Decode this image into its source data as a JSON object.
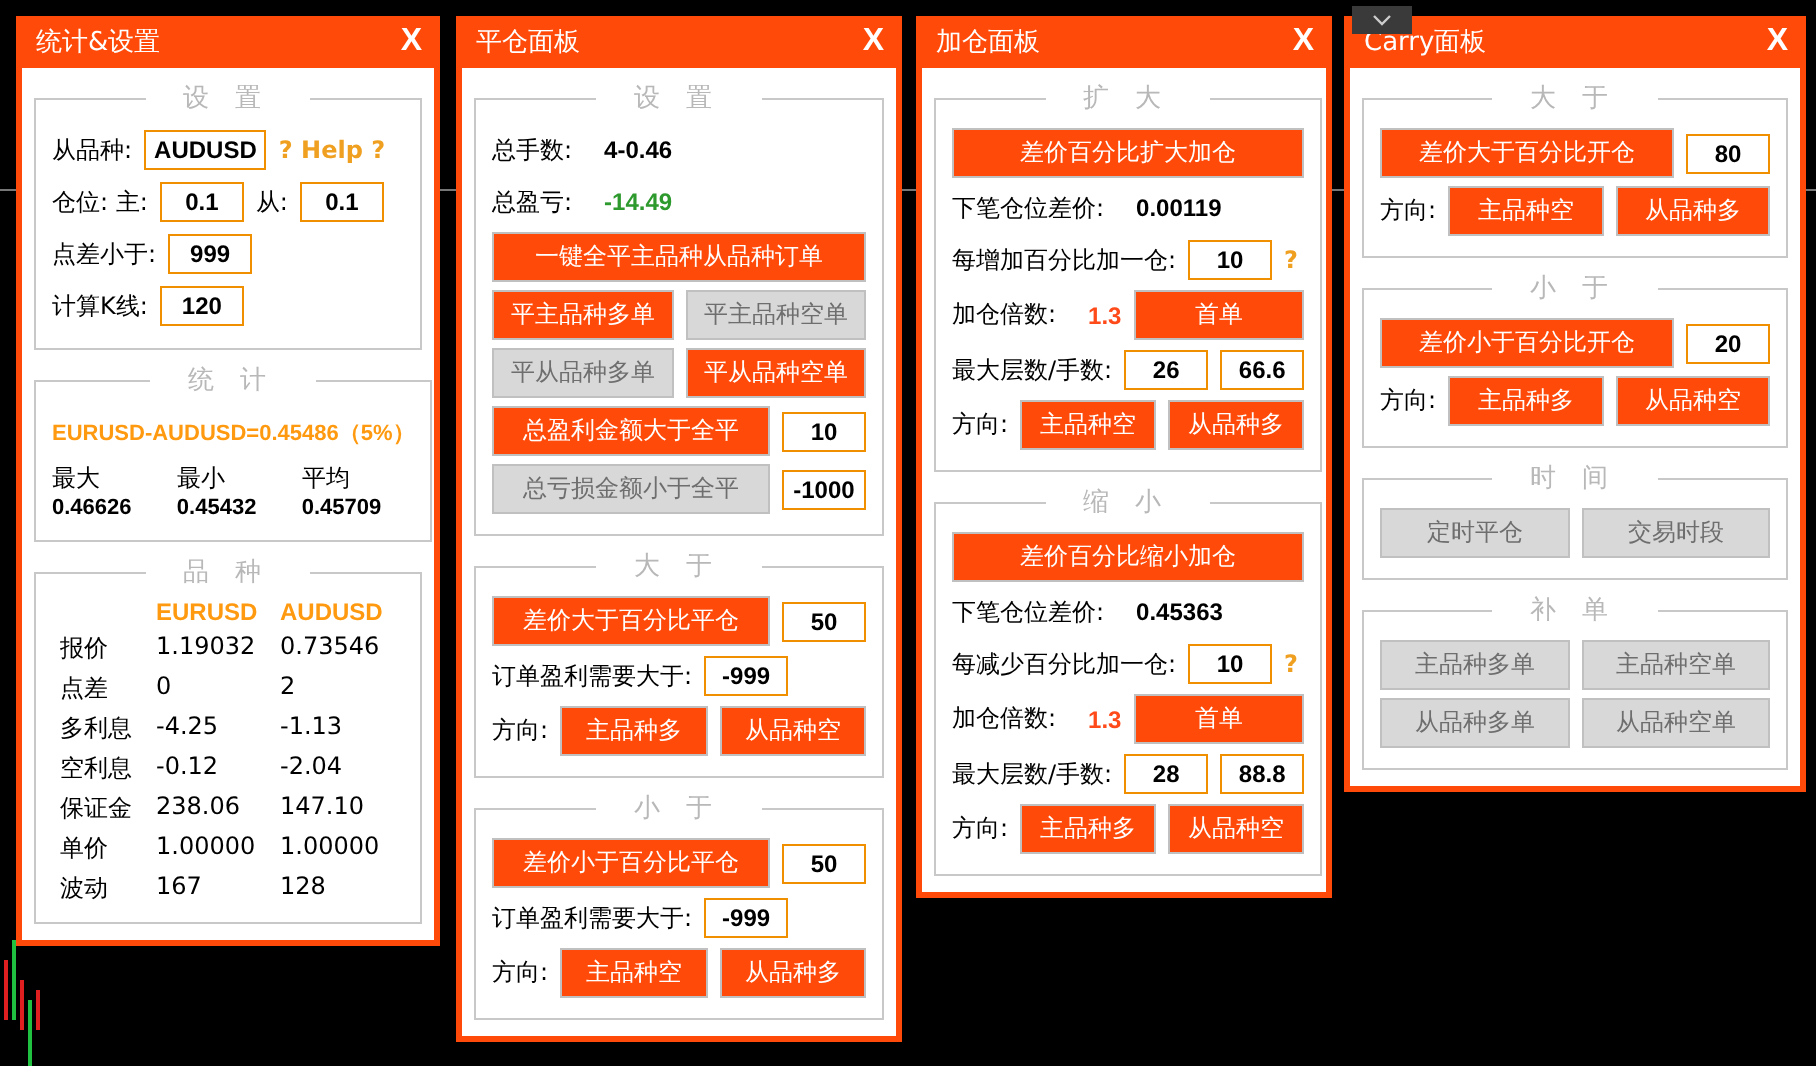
{
  "panels": [
    {
      "title": "统计&设置",
      "close": "X",
      "sections": [
        {
          "title": "设置",
          "kind": "rows",
          "rows": [
            {
              "items": [
                {
                  "kind": "label",
                  "text": "从品种:"
                },
                {
                  "kind": "input",
                  "text": "AUDUSD"
                },
                {
                  "kind": "help",
                  "text": "? Help ?"
                }
              ]
            },
            {
              "items": [
                {
                  "kind": "label",
                  "text": "仓位: 主:"
                },
                {
                  "kind": "input",
                  "text": "0.1"
                },
                {
                  "kind": "label",
                  "text": "从:"
                },
                {
                  "kind": "input",
                  "text": "0.1"
                }
              ]
            },
            {
              "items": [
                {
                  "kind": "label",
                  "text": "点差小于:"
                },
                {
                  "kind": "input",
                  "text": "999"
                }
              ]
            },
            {
              "items": [
                {
                  "kind": "label",
                  "text": "计算K线:"
                },
                {
                  "kind": "input",
                  "text": "120"
                }
              ]
            }
          ]
        },
        {
          "title": "统计",
          "kind": "rows",
          "rows": [
            {
              "items": [
                {
                  "kind": "formula",
                  "text": "EURUSD-AUDUSD=0.45486（5%）"
                }
              ]
            },
            {
              "items": [
                {
                  "kind": "stat",
                  "label": "最大",
                  "value": "0.46626"
                },
                {
                  "kind": "stat",
                  "label": "最小",
                  "value": "0.45432"
                },
                {
                  "kind": "stat",
                  "label": "平均",
                  "value": "0.45709"
                }
              ]
            }
          ]
        },
        {
          "title": "品种",
          "kind": "table",
          "columns": [
            "EURUSD",
            "AUDUSD"
          ],
          "rows": [
            {
              "label": "报价",
              "values": [
                "1.19032",
                "0.73546"
              ]
            },
            {
              "label": "点差",
              "values": [
                "0",
                "2"
              ]
            },
            {
              "label": "多利息",
              "values": [
                "-4.25",
                "-1.13"
              ]
            },
            {
              "label": "空利息",
              "values": [
                "-0.12",
                "-2.04"
              ]
            },
            {
              "label": "保证金",
              "values": [
                "238.06",
                "147.10"
              ]
            },
            {
              "label": "单价",
              "values": [
                "1.00000",
                "1.00000"
              ]
            },
            {
              "label": "波动",
              "values": [
                "167",
                "128"
              ]
            }
          ]
        }
      ]
    },
    {
      "title": "平仓面板",
      "close": "X",
      "sections": [
        {
          "title": "设置",
          "kind": "rows",
          "rows": [
            {
              "items": [
                {
                  "kind": "label",
                  "text": "总手数:"
                },
                {
                  "kind": "value",
                  "text": "4-0.46"
                }
              ]
            },
            {
              "items": [
                {
                  "kind": "label",
                  "text": "总盈亏:"
                },
                {
                  "kind": "value",
                  "text": "-14.49",
                  "color": "#2e9a2e"
                }
              ]
            },
            {
              "items": [
                {
                  "kind": "button",
                  "text": "一键全平主品种从品种订单",
                  "on": true
                }
              ]
            },
            {
              "items": [
                {
                  "kind": "button",
                  "text": "平主品种多单",
                  "on": true
                },
                {
                  "kind": "button",
                  "text": "平主品种空单",
                  "on": false
                }
              ]
            },
            {
              "items": [
                {
                  "kind": "button",
                  "text": "平从品种多单",
                  "on": false
                },
                {
                  "kind": "button",
                  "text": "平从品种空单",
                  "on": true
                }
              ]
            },
            {
              "items": [
                {
                  "kind": "button",
                  "text": "总盈利金额大于全平",
                  "on": true
                },
                {
                  "kind": "input",
                  "text": "10"
                }
              ]
            },
            {
              "items": [
                {
                  "kind": "button",
                  "text": "总亏损金额小于全平",
                  "on": false
                },
                {
                  "kind": "input",
                  "text": "-1000"
                }
              ]
            }
          ]
        },
        {
          "title": "大于",
          "kind": "rows",
          "rows": [
            {
              "items": [
                {
                  "kind": "button",
                  "text": "差价大于百分比平仓",
                  "on": true
                },
                {
                  "kind": "input",
                  "text": "50"
                }
              ]
            },
            {
              "items": [
                {
                  "kind": "label",
                  "text": "订单盈利需要大于:"
                },
                {
                  "kind": "input",
                  "text": "-999"
                }
              ]
            },
            {
              "label": "方向:",
              "items": [
                {
                  "kind": "button",
                  "text": "主品种多",
                  "on": true
                },
                {
                  "kind": "button",
                  "text": "从品种空",
                  "on": true
                }
              ]
            }
          ]
        },
        {
          "title": "小于",
          "kind": "rows",
          "rows": [
            {
              "items": [
                {
                  "kind": "button",
                  "text": "差价小于百分比平仓",
                  "on": true
                },
                {
                  "kind": "input",
                  "text": "50"
                }
              ]
            },
            {
              "items": [
                {
                  "kind": "label",
                  "text": "订单盈利需要大于:"
                },
                {
                  "kind": "input",
                  "text": "-999"
                }
              ]
            },
            {
              "label": "方向:",
              "items": [
                {
                  "kind": "button",
                  "text": "主品种空",
                  "on": true
                },
                {
                  "kind": "button",
                  "text": "从品种多",
                  "on": true
                }
              ]
            }
          ]
        }
      ]
    },
    {
      "title": "加仓面板",
      "close": "X",
      "sections": [
        {
          "title": "扩大",
          "kind": "rows",
          "rows": [
            {
              "items": [
                {
                  "kind": "button",
                  "text": "差价百分比扩大加仓",
                  "on": true
                }
              ]
            },
            {
              "items": [
                {
                  "kind": "label",
                  "text": "下笔仓位差价:"
                },
                {
                  "kind": "value",
                  "text": "0.00119"
                }
              ]
            },
            {
              "items": [
                {
                  "kind": "label",
                  "text": "每增加百分比加一仓:"
                },
                {
                  "kind": "input",
                  "text": "10"
                },
                {
                  "kind": "help",
                  "text": "?"
                }
              ]
            },
            {
              "items": [
                {
                  "kind": "label",
                  "text": "加仓倍数:"
                },
                {
                  "kind": "value",
                  "text": "1.3",
                  "color": "#ff4a1a"
                },
                {
                  "kind": "button",
                  "text": "首单",
                  "on": true
                }
              ]
            },
            {
              "items": [
                {
                  "kind": "label",
                  "text": "最大层数/手数:"
                },
                {
                  "kind": "input",
                  "text": "26"
                },
                {
                  "kind": "input",
                  "text": "66.6"
                }
              ]
            },
            {
              "label": "方向:",
              "items": [
                {
                  "kind": "button",
                  "text": "主品种空",
                  "on": true
                },
                {
                  "kind": "button",
                  "text": "从品种多",
                  "on": true
                }
              ]
            }
          ]
        },
        {
          "title": "缩小",
          "kind": "rows",
          "rows": [
            {
              "items": [
                {
                  "kind": "button",
                  "text": "差价百分比缩小加仓",
                  "on": true
                }
              ]
            },
            {
              "items": [
                {
                  "kind": "label",
                  "text": "下笔仓位差价:"
                },
                {
                  "kind": "value",
                  "text": "0.45363"
                }
              ]
            },
            {
              "items": [
                {
                  "kind": "label",
                  "text": "每减少百分比加一仓:"
                },
                {
                  "kind": "input",
                  "text": "10"
                },
                {
                  "kind": "help",
                  "text": "?"
                }
              ]
            },
            {
              "items": [
                {
                  "kind": "label",
                  "text": "加仓倍数:"
                },
                {
                  "kind": "value",
                  "text": "1.3",
                  "color": "#ff4a1a"
                },
                {
                  "kind": "button",
                  "text": "首单",
                  "on": true
                }
              ]
            },
            {
              "items": [
                {
                  "kind": "label",
                  "text": "最大层数/手数:"
                },
                {
                  "kind": "input",
                  "text": "28"
                },
                {
                  "kind": "input",
                  "text": "88.8"
                }
              ]
            },
            {
              "label": "方向:",
              "items": [
                {
                  "kind": "button",
                  "text": "主品种多",
                  "on": true
                },
                {
                  "kind": "button",
                  "text": "从品种空",
                  "on": true
                }
              ]
            }
          ]
        }
      ]
    },
    {
      "title": "Carry面板",
      "close": "X",
      "sections": [
        {
          "title": "大于",
          "kind": "rows",
          "rows": [
            {
              "items": [
                {
                  "kind": "button",
                  "text": "差价大于百分比开仓",
                  "on": true
                },
                {
                  "kind": "input",
                  "text": "80"
                }
              ]
            },
            {
              "label": "方向:",
              "items": [
                {
                  "kind": "button",
                  "text": "主品种空",
                  "on": true
                },
                {
                  "kind": "button",
                  "text": "从品种多",
                  "on": true
                }
              ]
            }
          ]
        },
        {
          "title": "小于",
          "kind": "rows",
          "rows": [
            {
              "items": [
                {
                  "kind": "button",
                  "text": "差价小于百分比开仓",
                  "on": true
                },
                {
                  "kind": "input",
                  "text": "20"
                }
              ]
            },
            {
              "label": "方向:",
              "items": [
                {
                  "kind": "button",
                  "text": "主品种多",
                  "on": true
                },
                {
                  "kind": "button",
                  "text": "从品种空",
                  "on": true
                }
              ]
            }
          ]
        },
        {
          "title": "时间",
          "kind": "rows",
          "rows": [
            {
              "items": [
                {
                  "kind": "button",
                  "text": "定时平仓",
                  "on": false
                },
                {
                  "kind": "button",
                  "text": "交易时段",
                  "on": false
                }
              ]
            }
          ]
        },
        {
          "title": "补单",
          "kind": "rows",
          "rows": [
            {
              "items": [
                {
                  "kind": "button",
                  "text": "主品种多单",
                  "on": false
                },
                {
                  "kind": "button",
                  "text": "主品种空单",
                  "on": false
                }
              ]
            },
            {
              "items": [
                {
                  "kind": "button",
                  "text": "从品种多单",
                  "on": false
                },
                {
                  "kind": "button",
                  "text": "从品种空单",
                  "on": false
                }
              ]
            }
          ]
        }
      ]
    }
  ]
}
